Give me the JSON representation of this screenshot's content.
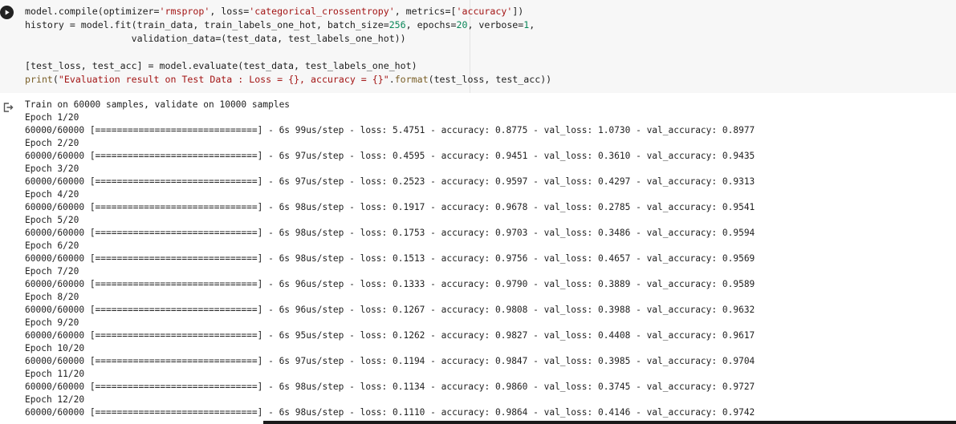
{
  "colors": {
    "default": "#212121",
    "string": "#a31515",
    "number": "#098658",
    "builtin": "#795e26",
    "cell_background": "#f7f7f7"
  },
  "icons": {
    "run": "play-circle-icon",
    "output": "output-arrow-icon"
  },
  "code": {
    "lines": [
      [
        {
          "t": "model.compile(optimizer=",
          "c": "default"
        },
        {
          "t": "'rmsprop'",
          "c": "string"
        },
        {
          "t": ", loss=",
          "c": "default"
        },
        {
          "t": "'categorical_crossentropy'",
          "c": "string"
        },
        {
          "t": ", metrics=[",
          "c": "default"
        },
        {
          "t": "'accuracy'",
          "c": "string"
        },
        {
          "t": "])",
          "c": "default"
        }
      ],
      [
        {
          "t": "history = model.fit(train_data, train_labels_one_hot, batch_size=",
          "c": "default"
        },
        {
          "t": "256",
          "c": "number"
        },
        {
          "t": ", epochs=",
          "c": "default"
        },
        {
          "t": "20",
          "c": "number"
        },
        {
          "t": ", verbose=",
          "c": "default"
        },
        {
          "t": "1",
          "c": "number"
        },
        {
          "t": ",",
          "c": "default"
        }
      ],
      [
        {
          "t": "                   validation_data=(test_data, test_labels_one_hot))",
          "c": "default"
        }
      ],
      [
        {
          "t": "",
          "c": "default"
        }
      ],
      [
        {
          "t": "[test_loss, test_acc] = model.evaluate(test_data, test_labels_one_hot)",
          "c": "default"
        }
      ],
      [
        {
          "t": "print",
          "c": "builtin"
        },
        {
          "t": "(",
          "c": "default"
        },
        {
          "t": "\"Evaluation result on Test Data : Loss = {}, accuracy = {}\"",
          "c": "string"
        },
        {
          "t": ".",
          "c": "default"
        },
        {
          "t": "format",
          "c": "builtin"
        },
        {
          "t": "(test_loss, test_acc))",
          "c": "default"
        }
      ]
    ]
  },
  "output": {
    "lines": [
      "Train on 60000 samples, validate on 10000 samples",
      "Epoch 1/20",
      "60000/60000 [==============================] - 6s 99us/step - loss: 5.4751 - accuracy: 0.8775 - val_loss: 1.0730 - val_accuracy: 0.8977",
      "Epoch 2/20",
      "60000/60000 [==============================] - 6s 97us/step - loss: 0.4595 - accuracy: 0.9451 - val_loss: 0.3610 - val_accuracy: 0.9435",
      "Epoch 3/20",
      "60000/60000 [==============================] - 6s 97us/step - loss: 0.2523 - accuracy: 0.9597 - val_loss: 0.4297 - val_accuracy: 0.9313",
      "Epoch 4/20",
      "60000/60000 [==============================] - 6s 98us/step - loss: 0.1917 - accuracy: 0.9678 - val_loss: 0.2785 - val_accuracy: 0.9541",
      "Epoch 5/20",
      "60000/60000 [==============================] - 6s 98us/step - loss: 0.1753 - accuracy: 0.9703 - val_loss: 0.3486 - val_accuracy: 0.9594",
      "Epoch 6/20",
      "60000/60000 [==============================] - 6s 98us/step - loss: 0.1513 - accuracy: 0.9756 - val_loss: 0.4657 - val_accuracy: 0.9569",
      "Epoch 7/20",
      "60000/60000 [==============================] - 6s 96us/step - loss: 0.1333 - accuracy: 0.9790 - val_loss: 0.3889 - val_accuracy: 0.9589",
      "Epoch 8/20",
      "60000/60000 [==============================] - 6s 96us/step - loss: 0.1267 - accuracy: 0.9808 - val_loss: 0.3988 - val_accuracy: 0.9632",
      "Epoch 9/20",
      "60000/60000 [==============================] - 6s 95us/step - loss: 0.1262 - accuracy: 0.9827 - val_loss: 0.4408 - val_accuracy: 0.9617",
      "Epoch 10/20",
      "60000/60000 [==============================] - 6s 97us/step - loss: 0.1194 - accuracy: 0.9847 - val_loss: 0.3985 - val_accuracy: 0.9704",
      "Epoch 11/20",
      "60000/60000 [==============================] - 6s 98us/step - loss: 0.1134 - accuracy: 0.9860 - val_loss: 0.3745 - val_accuracy: 0.9727",
      "Epoch 12/20",
      "60000/60000 [==============================] - 6s 98us/step - loss: 0.1110 - accuracy: 0.9864 - val_loss: 0.4146 - val_accuracy: 0.9742"
    ]
  }
}
